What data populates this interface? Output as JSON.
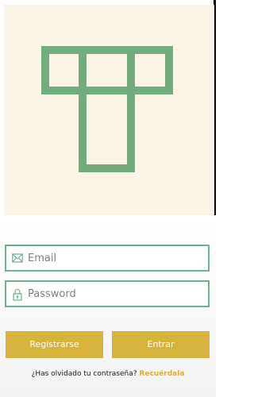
{
  "colors": {
    "logo_background": "#fbf5e8",
    "logo_stroke": "#73ac7f",
    "field_border": "#6fb18a",
    "button_background": "#d5b33c",
    "link_color": "#d5b33c"
  },
  "logo": {
    "icon": "t-grid-logo-icon"
  },
  "login": {
    "email_icon": "mail-icon",
    "email_placeholder": "Email",
    "email_value": "",
    "password_icon": "lock-icon",
    "password_placeholder": "Password",
    "password_value": "",
    "register_label": "Registrarse",
    "enter_label": "Entrar",
    "forgot_text": "¿Has olvidado tu contraseña?",
    "forgot_link": "Recuérdala"
  }
}
